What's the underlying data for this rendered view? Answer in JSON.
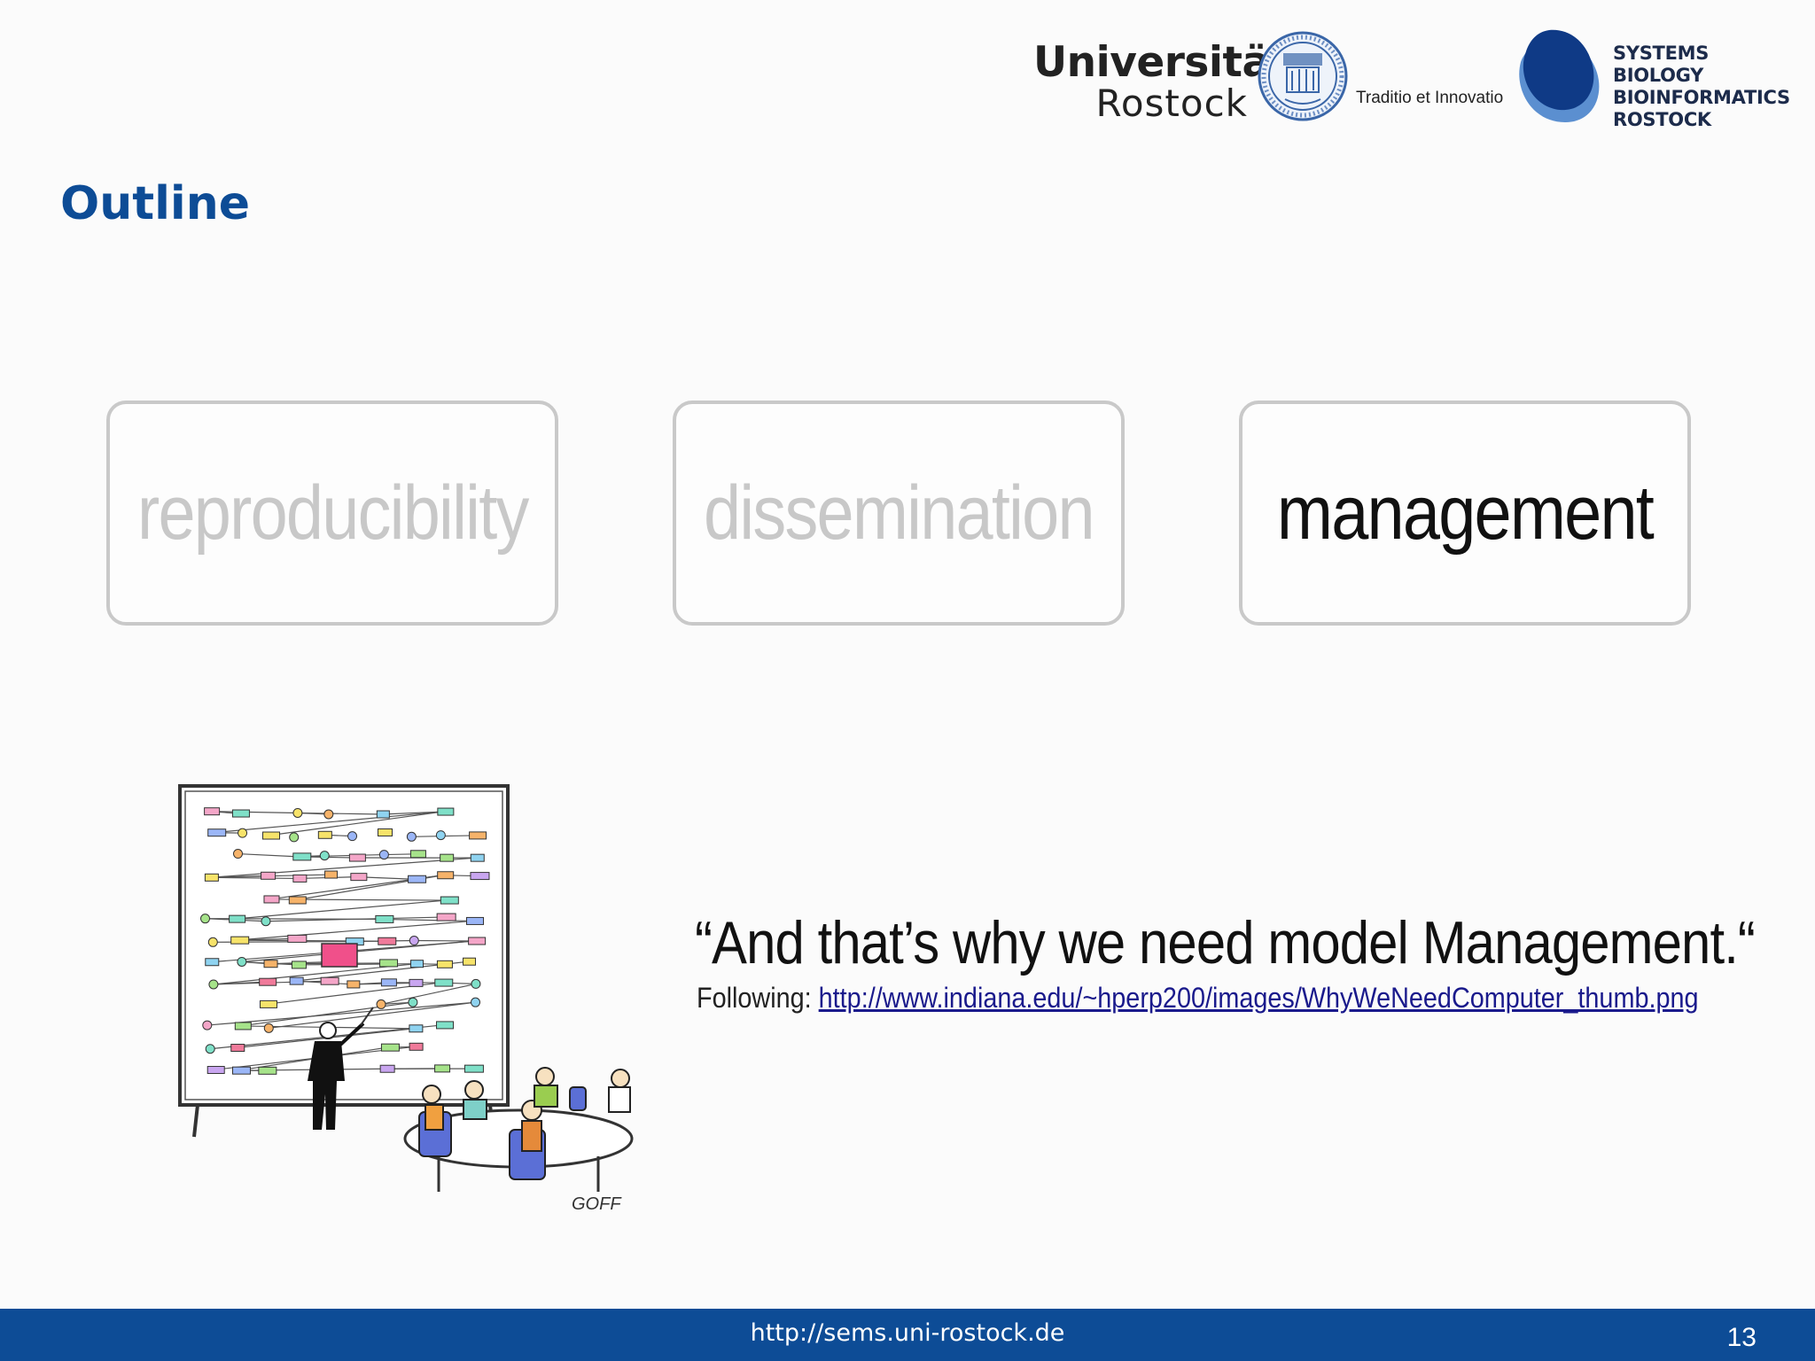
{
  "header": {
    "university_line1": "Universität",
    "university_line2": "Rostock",
    "motto": "Traditio et Innovatio",
    "sbi_line1": "SYSTEMS BIOLOGY",
    "sbi_line2": "BIOINFORMATICS",
    "sbi_line3": "ROSTOCK",
    "seal_icon": "university-seal-icon",
    "brand_color": "#0d4c96"
  },
  "slide": {
    "title": "Outline",
    "topics": [
      {
        "label": "reproducibility",
        "state": "faded"
      },
      {
        "label": "dissemination",
        "state": "faded"
      },
      {
        "label": "management",
        "state": "active"
      }
    ],
    "cartoon_icon": "cartoon-complex-diagram-meeting",
    "cartoon_signature": "GOFF",
    "quote": "“And that’s why we need model Management.“",
    "source_prefix": "Following: ",
    "source_link": "http://www.indiana.edu/~hperp200/images/WhyWeNeedComputer_thumb.png"
  },
  "footer": {
    "url": "http://sems.uni-rostock.de",
    "page_number": "13"
  }
}
